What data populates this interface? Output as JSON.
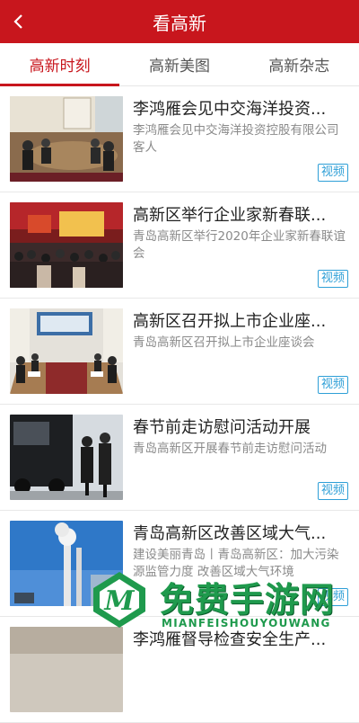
{
  "header": {
    "title": "看高新",
    "back_icon": "chevron-left-icon",
    "bg_color": "#c8161d"
  },
  "tabs": [
    {
      "label": "高新时刻",
      "active": true
    },
    {
      "label": "高新美图",
      "active": false
    },
    {
      "label": "高新杂志",
      "active": false
    }
  ],
  "items": [
    {
      "title": "李鸿雁会见中交海洋投资...",
      "desc": "李鸿雁会见中交海洋投资控股有限公司客人",
      "badge": "视频"
    },
    {
      "title": "高新区举行企业家新春联...",
      "desc": "青岛高新区举行2020年企业家新春联谊会",
      "badge": "视频"
    },
    {
      "title": "高新区召开拟上市企业座...",
      "desc": "青岛高新区召开拟上市企业座谈会",
      "badge": "视频"
    },
    {
      "title": "春节前走访慰问活动开展",
      "desc": "青岛高新区开展春节前走访慰问活动",
      "badge": "视频"
    },
    {
      "title": "青岛高新区改善区域大气...",
      "desc": "建设美丽青岛丨青岛高新区：加大污染源监管力度 改善区域大气环境",
      "badge": "视频"
    },
    {
      "title": "李鸿雁督导检查安全生产...",
      "desc": "",
      "badge": ""
    }
  ],
  "watermark": {
    "text": "免费手游网",
    "sub": "MIANFEISHOUYOUWANG",
    "logo_letter": "M"
  },
  "accent_colors": {
    "link_badge": "#2e9fd7",
    "active_tab": "#c8161d"
  }
}
